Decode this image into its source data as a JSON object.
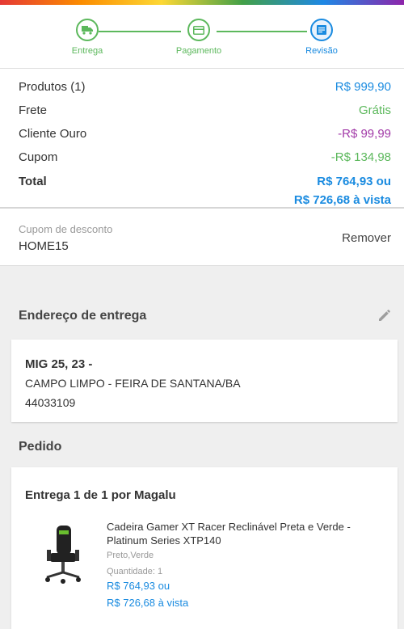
{
  "steps": [
    {
      "label": "Entrega",
      "icon": "truck-icon"
    },
    {
      "label": "Pagamento",
      "icon": "card-icon"
    },
    {
      "label": "Revisão",
      "icon": "document-icon"
    }
  ],
  "colors": {
    "green": "#5cb85c",
    "blue": "#1a8be0",
    "purple": "#a23aa8",
    "gray": "#777777"
  },
  "summary": {
    "produtos": {
      "label": "Produtos (1)",
      "value": "R$ 999,90"
    },
    "frete": {
      "label": "Frete",
      "value": "Grátis"
    },
    "cliente_ouro": {
      "label": "Cliente Ouro",
      "value": "-R$ 99,99"
    },
    "cupom": {
      "label": "Cupom",
      "value": "-R$ 134,98"
    },
    "total": {
      "label": "Total",
      "value_line1": "R$ 764,93 ou",
      "value_line2": "R$ 726,68 à vista"
    }
  },
  "coupon": {
    "label": "Cupom de desconto",
    "code": "HOME15",
    "remove": "Remover"
  },
  "address": {
    "title": "Endereço de entrega",
    "line1": "MIG 25, 23 -",
    "line2": "CAMPO LIMPO - FEIRA DE SANTANA/BA",
    "line3": "44033109"
  },
  "order": {
    "title": "Pedido",
    "delivery": "Entrega 1 de 1 por Magalu",
    "product": {
      "name_line1": "Cadeira Gamer XT Racer Reclinável Preta e Verde -",
      "name_line2": "Platinum Series XTP140",
      "variant": "Preto,Verde",
      "quantity": "Quantidade: 1",
      "price_line1": "R$ 764,93 ou",
      "price_line2": "R$ 726,68 à vista"
    }
  }
}
